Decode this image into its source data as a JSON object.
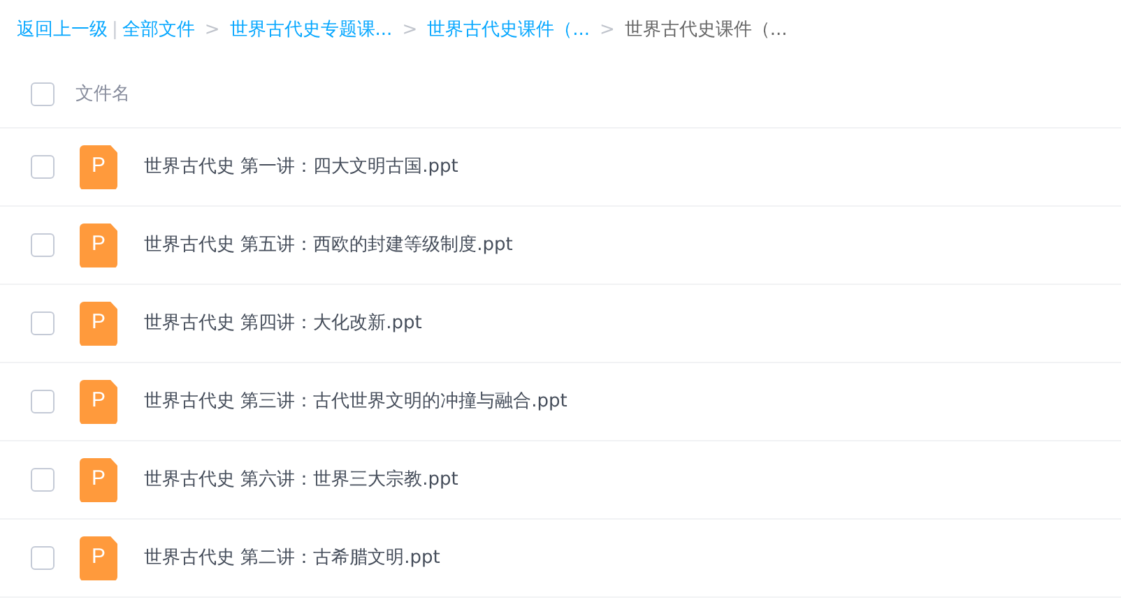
{
  "breadcrumb": [
    {
      "kind": "link",
      "text": "返回上一级"
    },
    {
      "kind": "divider",
      "text": "|"
    },
    {
      "kind": "link",
      "text": "全部文件"
    },
    {
      "kind": "arrow",
      "text": ">"
    },
    {
      "kind": "link",
      "text": "世界古代史专题课..."
    },
    {
      "kind": "arrow",
      "text": ">"
    },
    {
      "kind": "link",
      "text": "世界古代史课件（..."
    },
    {
      "kind": "arrow",
      "text": ">"
    },
    {
      "kind": "current",
      "text": "世界古代史课件（..."
    }
  ],
  "header": {
    "label": "文件名",
    "checked": false
  },
  "files": [
    {
      "name": "世界古代史 第一讲：四大文明古国.ppt",
      "icon_letter": "P",
      "checked": false
    },
    {
      "name": "世界古代史 第五讲：西欧的封建等级制度.ppt",
      "icon_letter": "P",
      "checked": false
    },
    {
      "name": "世界古代史 第四讲：大化改新.ppt",
      "icon_letter": "P",
      "checked": false
    },
    {
      "name": "世界古代史 第三讲：古代世界文明的冲撞与融合.ppt",
      "icon_letter": "P",
      "checked": false
    },
    {
      "name": "世界古代史 第六讲：世界三大宗教.ppt",
      "icon_letter": "P",
      "checked": false
    },
    {
      "name": "世界古代史 第二讲：古希腊文明.ppt",
      "icon_letter": "P",
      "checked": false
    }
  ]
}
